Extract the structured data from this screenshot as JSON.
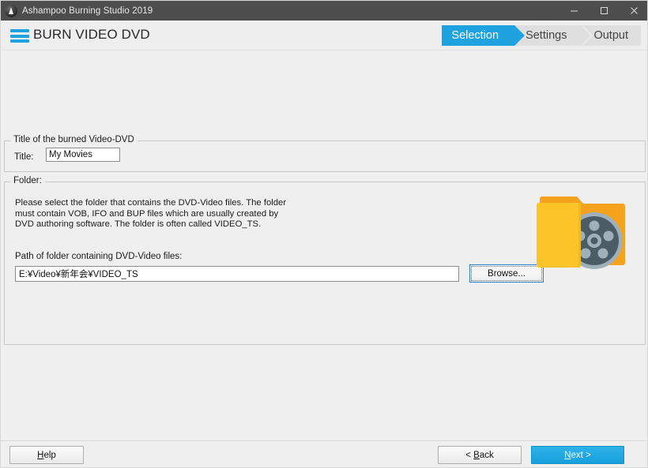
{
  "window": {
    "title": "Ashampoo Burning Studio 2019",
    "app_icon": "flame-disc-icon",
    "controls": {
      "minimize": "minimize-icon",
      "maximize": "maximize-icon",
      "close": "close-icon"
    }
  },
  "header": {
    "menu_icon": "hamburger-menu-icon",
    "title": "BURN VIDEO DVD",
    "steps": [
      {
        "label": "Selection",
        "state": "active"
      },
      {
        "label": "Settings",
        "state": "inactive"
      },
      {
        "label": "Output",
        "state": "inactive"
      }
    ],
    "accent_color": "#1fa3e0"
  },
  "title_group": {
    "legend": "Title of the burned Video-DVD",
    "label": "Title:",
    "value": "My Movies",
    "placeholder": ""
  },
  "folder_group": {
    "legend": "Folder:",
    "description": "Please select the folder that contains the DVD-Video files. The folder must contain VOB, IFO and BUP files which are usually created by DVD authoring software. The folder is often called VIDEO_TS.",
    "path_label": "Path of folder containing DVD-Video files:",
    "path_value": "E:¥Video¥新年会¥VIDEO_TS",
    "path_placeholder": "",
    "browse_label": "Browse...",
    "artwork": "folder-with-film-reel-icon",
    "artwork_colors": {
      "folder_front": "#fbc02d",
      "folder_back": "#f9a825",
      "reel_body": "#4b5c66",
      "reel_rim": "#9fb0ba"
    }
  },
  "footer": {
    "help": {
      "pre": "H",
      "accel": "H",
      "label_before": "",
      "label_after": "elp",
      "full": "Help"
    },
    "back": {
      "prefix": "< ",
      "accel": "B",
      "rest": "ack",
      "full": "< Back"
    },
    "next": {
      "prefix": "",
      "accel": "N",
      "rest": "ext >",
      "full": "Next >"
    }
  }
}
